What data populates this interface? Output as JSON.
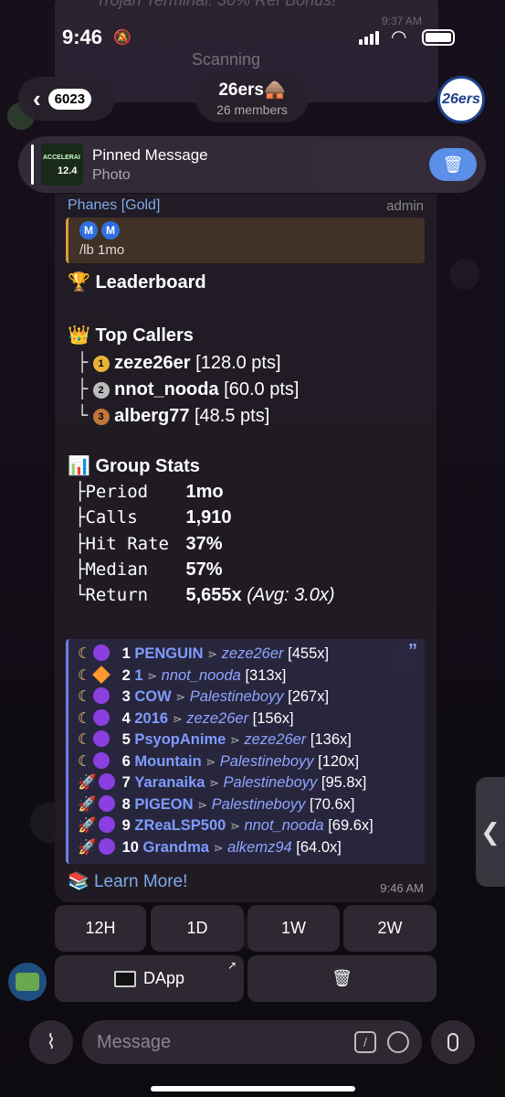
{
  "ghost": {
    "text": "Trojan Terminal: 30% Ref Bonus!",
    "scanning": "Scanning",
    "time": "9:37 AM"
  },
  "status_bar": {
    "time": "9:46"
  },
  "header": {
    "back_count": "6023",
    "title": "26ers",
    "title_emoji": "🛖",
    "members": "26 members",
    "avatar_text": "26ers"
  },
  "pinned": {
    "title": "Pinned Message",
    "subtitle": "Photo",
    "thumb_text": "ACCELERAI",
    "thumb_value": "12.4"
  },
  "message": {
    "sender": "Phanes [Gold]",
    "role": "admin",
    "reply_cmd": "/lb 1mo",
    "reply_emojis": [
      "M",
      "M"
    ],
    "leaderboard_title": "Leaderboard",
    "top_callers_title": "Top Callers",
    "top_callers": [
      {
        "tree": "├",
        "medal": "1",
        "name": "zeze26er",
        "pts": "[128.0 pts]"
      },
      {
        "tree": "├",
        "medal": "2",
        "name": "nnot_nooda",
        "pts": "[60.0 pts]"
      },
      {
        "tree": "└",
        "medal": "3",
        "name": "alberg77",
        "pts": "[48.5 pts]"
      }
    ],
    "group_stats_title": "Group Stats",
    "stats": [
      {
        "tree": "├",
        "label": "Period",
        "value": "1mo",
        "extra": ""
      },
      {
        "tree": "├",
        "label": "Calls",
        "value": "1,910",
        "extra": ""
      },
      {
        "tree": "├",
        "label": "Hit Rate",
        "value": "37%",
        "extra": ""
      },
      {
        "tree": "├",
        "label": "Median",
        "value": "57%",
        "extra": ""
      },
      {
        "tree": "└",
        "label": "Return",
        "value": "5,655x",
        "extra": "(Avg: 3.0x)"
      }
    ],
    "calls": [
      {
        "icon": "moon",
        "badge": "dot",
        "num": "1",
        "token": "PENGUIN",
        "user": "zeze26er",
        "mult": "[455x]"
      },
      {
        "icon": "moon",
        "badge": "diamond",
        "num": "2",
        "token": "1",
        "user": "nnot_nooda",
        "mult": "[313x]"
      },
      {
        "icon": "moon",
        "badge": "dot",
        "num": "3",
        "token": "COW",
        "user": "Palestineboyy",
        "mult": "[267x]"
      },
      {
        "icon": "moon",
        "badge": "dot",
        "num": "4",
        "token": "2016",
        "user": "zeze26er",
        "mult": "[156x]"
      },
      {
        "icon": "moon",
        "badge": "dot",
        "num": "5",
        "token": "PsyopAnime",
        "user": "zeze26er",
        "mult": "[136x]"
      },
      {
        "icon": "moon",
        "badge": "dot",
        "num": "6",
        "token": "Mountain",
        "user": "Palestineboyy",
        "mult": "[120x]"
      },
      {
        "icon": "rocket",
        "badge": "dot",
        "num": "7",
        "token": "Yaranaika",
        "user": "Palestineboyy",
        "mult": "[95.8x]"
      },
      {
        "icon": "rocket",
        "badge": "dot",
        "num": "8",
        "token": "PIGEON",
        "user": "Palestineboyy",
        "mult": "[70.6x]"
      },
      {
        "icon": "rocket",
        "badge": "dot",
        "num": "9",
        "token": "ZReaLSP500",
        "user": "nnot_nooda",
        "mult": "[69.6x]"
      },
      {
        "icon": "rocket",
        "badge": "dot",
        "num": "10",
        "token": "Grandma",
        "user": "alkemz94",
        "mult": "[64.0x]"
      }
    ],
    "learn_more": "Learn More!",
    "time": "9:46 AM"
  },
  "keyboard": {
    "row1": [
      "12H",
      "1D",
      "1W",
      "2W"
    ],
    "dapp_label": "DApp"
  },
  "composer": {
    "placeholder": "Message"
  },
  "colors": {
    "accent_blue": "#7ea9e8",
    "call_token": "#7e9bff",
    "trash_button": "#5b8fe8"
  }
}
